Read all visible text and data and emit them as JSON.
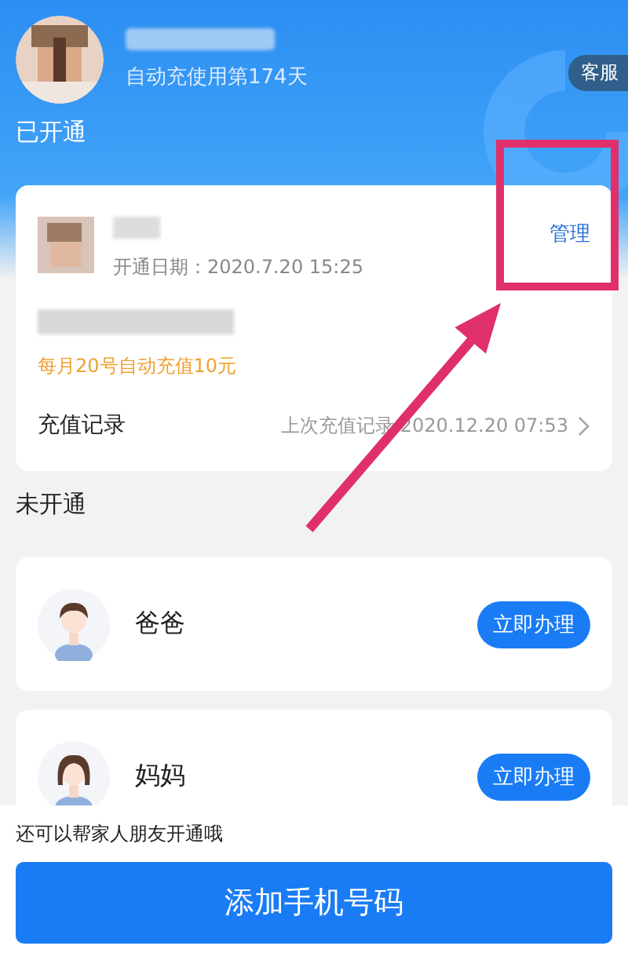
{
  "header": {
    "usage": "自动充使用第174天",
    "service": "客服"
  },
  "active_section": {
    "title": "已开通",
    "card": {
      "open_date": "开通日期：2020.7.20 15:25",
      "manage": "管理",
      "auto_recharge": "每月20号自动充值10元",
      "record_label": "充值记录",
      "record_last": "上次充值记录 2020.12.20 07:53"
    }
  },
  "inactive_section": {
    "title": "未开通",
    "members": [
      {
        "name": "爸爸",
        "action": "立即办理",
        "kind": "male"
      },
      {
        "name": "妈妈",
        "action": "立即办理",
        "kind": "female"
      }
    ]
  },
  "footer": {
    "hint": "还可以帮家人朋友开通哦",
    "button": "添加手机号码"
  }
}
